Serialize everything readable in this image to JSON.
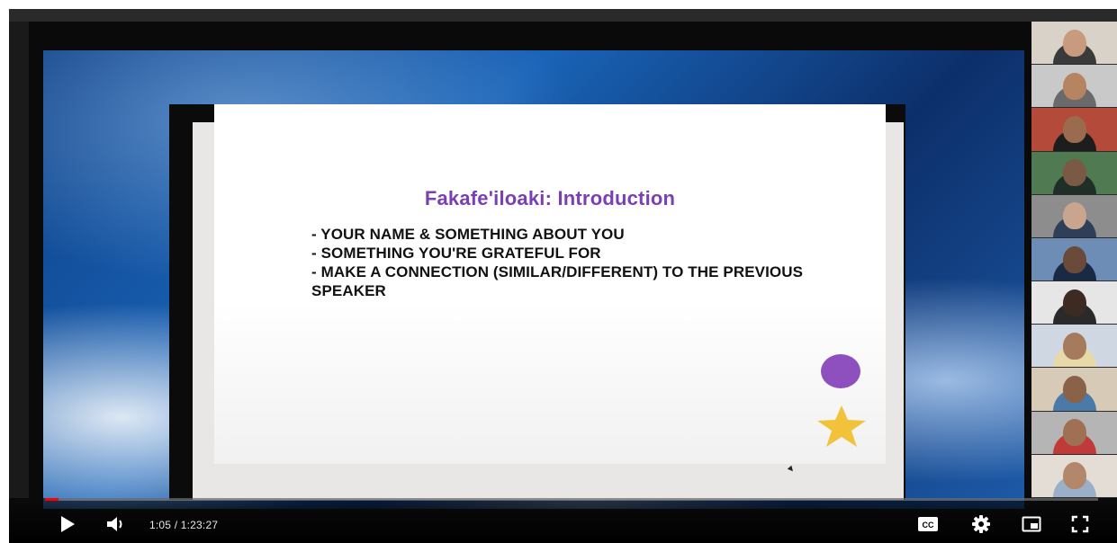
{
  "slide": {
    "title": "Fakafe'iloaki: Introduction",
    "bullets": [
      "- YOUR NAME & SOMETHING ABOUT YOU",
      "- SOMETHING YOU'RE GRATEFUL FOR",
      "- MAKE A CONNECTION (SIMILAR/DIFFERENT) TO THE PREVIOUS SPEAKER"
    ],
    "accent_color": "#7b3fb5",
    "circle_color": "#8e4fbf",
    "star_color": "#f2c23a"
  },
  "player": {
    "current_time": "1:05",
    "separator": " / ",
    "duration": "1:23:27",
    "progress": 0.013,
    "progress_color": "#ff0000",
    "controls": {
      "play": "play-icon",
      "volume": "volume-icon",
      "captions": "CC",
      "settings": "gear-icon",
      "miniplayer": "miniplayer-icon",
      "fullscreen": "fullscreen-icon"
    }
  },
  "participants": {
    "count": 11,
    "tiles": [
      {
        "bg": "#d9d2c8",
        "skin": "#c89a7e",
        "shirt": "#3a3a3a"
      },
      {
        "bg": "#c9c9c9",
        "skin": "#b78462",
        "shirt": "#6a6a6a"
      },
      {
        "bg": "#b34a3a",
        "skin": "#9b6b50",
        "shirt": "#1d1d1d"
      },
      {
        "bg": "#4f7a52",
        "skin": "#7a5a44",
        "shirt": "#1f2f27"
      },
      {
        "bg": "#8d8d8d",
        "skin": "#caa58e",
        "shirt": "#2f3f5a"
      },
      {
        "bg": "#6d8db7",
        "skin": "#6a4a38",
        "shirt": "#1a2a44"
      },
      {
        "bg": "#e6e6e6",
        "skin": "#3d2a22",
        "shirt": "#2a2a2a"
      },
      {
        "bg": "#cfd8e2",
        "skin": "#a67a5c",
        "shirt": "#e8d9a8"
      },
      {
        "bg": "#d7cbb8",
        "skin": "#8a6248",
        "shirt": "#4a7aa8"
      },
      {
        "bg": "#b5b5b5",
        "skin": "#a07055",
        "shirt": "#c03a3a"
      },
      {
        "bg": "#e3ddd6",
        "skin": "#b3876a",
        "shirt": "#9ab0c8"
      }
    ]
  }
}
